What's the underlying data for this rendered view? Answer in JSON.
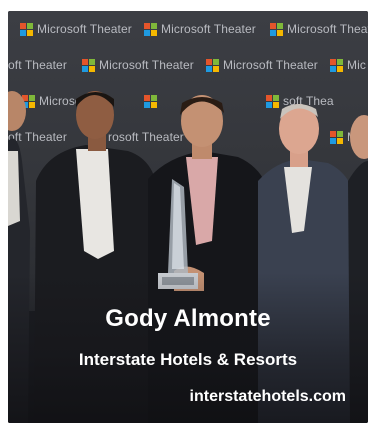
{
  "backdrop": {
    "logo_text": "Microsoft Theater",
    "logo_text_partial_left": "oft Theater",
    "logo_text_fragment": "rosoft Theater",
    "logo_text_fragment_right": "soft Thea",
    "logo_text_mic": "Mic",
    "logo_text_clip": "Microso"
  },
  "photo": {
    "subject": "five men in suits posing with a glass award in front of a Microsoft Theater step-and-repeat backdrop"
  },
  "caption": {
    "name": "Gody Almonte",
    "company": "Interstate Hotels & Resorts",
    "website": "interstatehotels.com"
  },
  "colors": {
    "card_bg": "#1b1d22",
    "caption_text": "#ffffff",
    "ms_red": "#e4552b",
    "ms_green": "#7fb83a",
    "ms_blue": "#1f9ae0",
    "ms_yellow": "#f5b800"
  }
}
